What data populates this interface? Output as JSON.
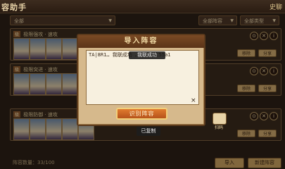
{
  "topbar": {
    "title": "容助手",
    "right_name": "史聊"
  },
  "filters": [
    {
      "label": "全部"
    },
    {
      "label": "全部阵容"
    },
    {
      "label": "全部类型"
    }
  ],
  "lineups": [
    {
      "tag": "极",
      "name": "极限强攻 · 速攻",
      "move_label": "移除",
      "share_label": "分享"
    },
    {
      "tag": "极",
      "name": "极限突进 · 速攻",
      "move_label": "移除",
      "share_label": "分享"
    },
    {
      "tag": "极",
      "name": "极限防御 · 速攻",
      "move_label": "移除",
      "share_label": "分享"
    }
  ],
  "dialog": {
    "title": "导入阵容",
    "textarea_value": "TA|8R1… 我联成功 … 29c39c55a1",
    "clear_icon": "×",
    "import_button": "识别阵容"
  },
  "toasts": {
    "success": "我联成功",
    "copied": "已复制"
  },
  "share_side": {
    "label": "扫码"
  },
  "bottom": {
    "count": "阵容数量：33/100",
    "btn_left": "导入",
    "btn_right": "新建阵容"
  },
  "colors": {
    "accent": "#c9a56a",
    "dialog_bg": "#d6b98c",
    "import_btn": "#e07b2e"
  }
}
